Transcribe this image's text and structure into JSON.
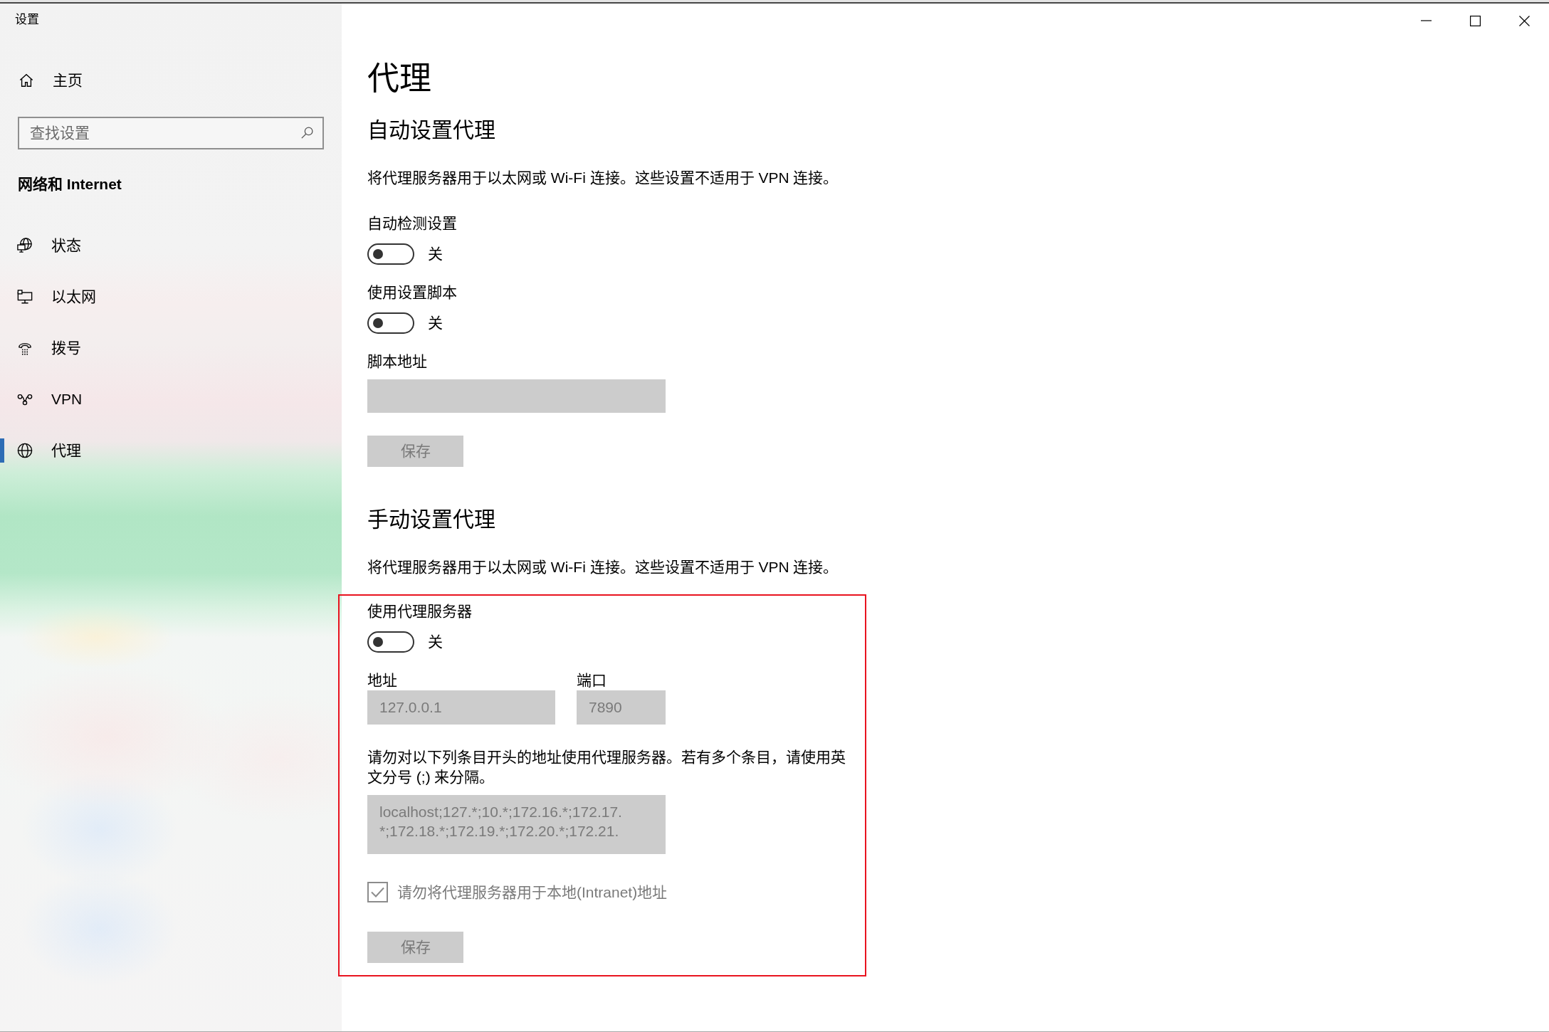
{
  "window": {
    "title": "设置"
  },
  "sidebar": {
    "home": {
      "label": "主页"
    },
    "search": {
      "placeholder": "查找设置"
    },
    "section_title": "网络和 Internet",
    "items": [
      {
        "kind": "status",
        "label": "状态",
        "selected": false
      },
      {
        "kind": "ethernet",
        "label": "以太网",
        "selected": false
      },
      {
        "kind": "dialup",
        "label": "拨号",
        "selected": false
      },
      {
        "kind": "vpn",
        "label": "VPN",
        "selected": false
      },
      {
        "kind": "proxy",
        "label": "代理",
        "selected": true
      }
    ]
  },
  "page": {
    "title": "代理",
    "sections": [
      {
        "heading": "自动设置代理",
        "description": "将代理服务器用于以太网或 Wi-Fi 连接。这些设置不适用于 VPN 连接。",
        "settings": [
          {
            "kind": "toggle",
            "label": "自动检测设置",
            "on": false,
            "state_text": "关"
          },
          {
            "kind": "toggle",
            "label": "使用设置脚本",
            "on": false,
            "state_text": "关"
          },
          {
            "kind": "field",
            "label": "脚本地址",
            "disabled": true
          },
          {
            "kind": "button",
            "label": "保存",
            "disabled": true
          }
        ]
      },
      {
        "heading": "手动设置代理",
        "description": "将代理服务器用于以太网或 Wi-Fi 连接。这些设置不适用于 VPN 连接。",
        "highlighted": true,
        "settings": [
          {
            "kind": "toggle",
            "label": "使用代理服务器",
            "on": false,
            "state_text": "关"
          },
          {
            "kind": "address",
            "fields": [
              {
                "label": "地址",
                "value": "127.0.0.1",
                "disabled": true
              },
              {
                "label": "端口",
                "value": "7890",
                "disabled": true
              }
            ]
          },
          {
            "kind": "note",
            "text": "请勿对以下列条目开头的地址使用代理服务器。若有多个条目，请使用英文分号 (;) 来分隔。"
          },
          {
            "kind": "textarea",
            "value": "localhost;127.*;10.*;172.16.*;172.17.\n*;172.18.*;172.19.*;172.20.*;172.21.",
            "disabled": true
          },
          {
            "kind": "checkbox",
            "label": "请勿将代理服务器用于本地(Intranet)地址",
            "checked": true,
            "disabled": true
          },
          {
            "kind": "button",
            "label": "保存",
            "disabled": true
          }
        ]
      }
    ]
  }
}
